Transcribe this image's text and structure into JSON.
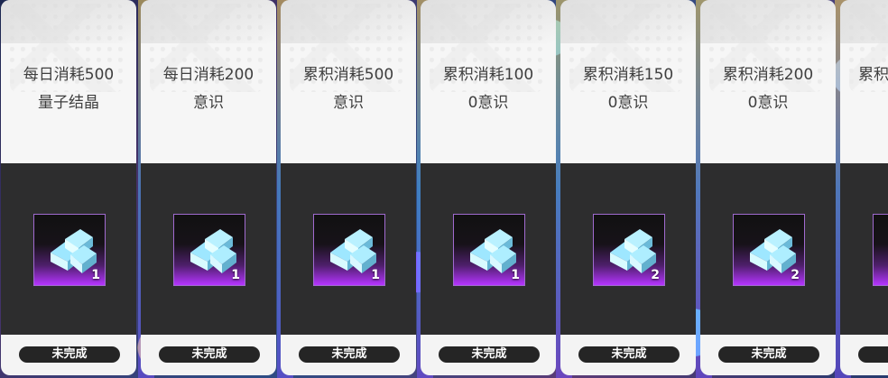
{
  "cards": [
    {
      "title_line1": "每日消耗500",
      "title_line2": "量子结晶",
      "reward_count": "1",
      "status": "未完成"
    },
    {
      "title_line1": "每日消耗200",
      "title_line2": "意识",
      "reward_count": "1",
      "status": "未完成"
    },
    {
      "title_line1": "累积消耗500",
      "title_line2": "意识",
      "reward_count": "1",
      "status": "未完成"
    },
    {
      "title_line1": "累积消耗100",
      "title_line2": "0意识",
      "reward_count": "1",
      "status": "未完成"
    },
    {
      "title_line1": "累积消耗150",
      "title_line2": "0意识",
      "reward_count": "2",
      "status": "未完成"
    },
    {
      "title_line1": "累积消耗200",
      "title_line2": "0意识",
      "reward_count": "2",
      "status": "未完成"
    },
    {
      "title_line1": "累积",
      "title_line2": "",
      "reward_count": "",
      "status": "未"
    }
  ],
  "icons": {
    "reward": "crystal-item-icon"
  }
}
